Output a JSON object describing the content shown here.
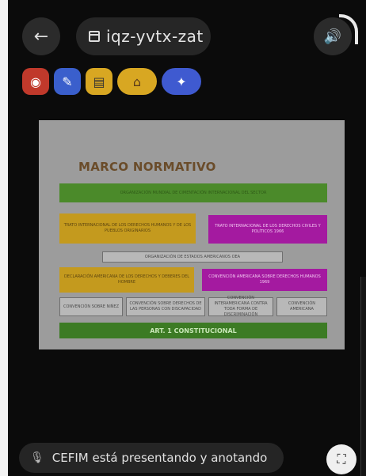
{
  "topbar": {
    "back_icon": "arrow-left-icon",
    "meeting_code": "iqz-yvtx-zat",
    "calendar_icon": "calendar-icon",
    "speaker_icon": "speaker-icon"
  },
  "reactions": [
    {
      "icon": "record-icon"
    },
    {
      "icon": "pencil-icon"
    },
    {
      "icon": "palette-icon"
    },
    {
      "icon": "door-icon"
    },
    {
      "icon": "sparkle-icon"
    }
  ],
  "slide": {
    "title": "MARCO NORMATIVO",
    "banner_top": "ORGANIZACIÓN MUNDIAL DE CIMENTACIÓN INTERNACIONAL DEL SECTOR",
    "yellow_left": "TRATO INTERNACIONAL DE LOS DERECHOS HUMANOS Y DE LOS PUEBLOS ORIGINARIOS",
    "magenta_right": "TRATO INTERNACIONAL DE LOS DERECHOS CIVILES Y POLÍTICOS 1966",
    "grey_middle": "ORGANIZACIÓN DE ESTADOS AMERICANOS OEA",
    "yellow_left2": "DECLARACIÓN AMERICANA DE LOS DERECHOS Y DEBERES DEL HOMBRE",
    "magenta_right2": "CONVENCIÓN AMERICANA SOBRE DERECHOS HUMANOS 1969",
    "grey_cells": [
      "CONVENCIÓN SOBRE NIÑEZ",
      "CONVENCIÓN SOBRE DERECHOS DE LAS PERSONAS CON DISCAPACIDAD",
      "CONVENCIÓN INTERAMERICANA CONTRA TODA FORMA DE DISCRIMINACIÓN",
      "CONVENCIÓN AMERICANA"
    ],
    "bottom_bar": "ART. 1 CONSTITUCIONAL"
  },
  "bottom": {
    "mic_icon": "mic-off-icon",
    "presenting_text": "CEFIM está presentando y anotando",
    "fullscreen_icon": "fullscreen-icon"
  }
}
